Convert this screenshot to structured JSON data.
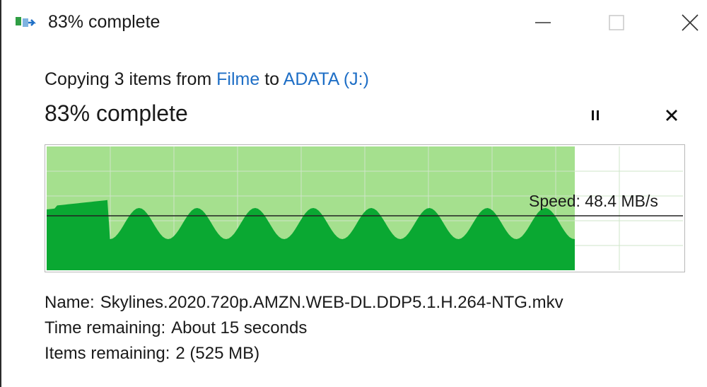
{
  "window": {
    "title": "83% complete",
    "controls": {
      "minimize": "minimize",
      "maximize": "maximize",
      "close": "close"
    }
  },
  "copy": {
    "prefix": "Copying 3 items from",
    "source": "Filme",
    "middle": "to",
    "destination": "ADATA (J:)"
  },
  "progress": {
    "label": "83% complete",
    "percent": 83
  },
  "speed": {
    "label": "Speed: 48.4 MB/s",
    "value_mb_s": 48.4
  },
  "details": {
    "name_label": "Name:",
    "name_value": "Skylines.2020.720p.AMZN.WEB-DL.DDP5.1.H.264-NTG.mkv",
    "time_label": "Time remaining:",
    "time_value": "About 15 seconds",
    "items_label": "Items remaining:",
    "items_value": "2 (525 MB)"
  },
  "colors": {
    "progress_fill": "#a5e08e",
    "speed_fill": "#0aa832",
    "grid": "#cfe5c8",
    "link": "#1f6fc6"
  },
  "icons": {
    "app": "file-copy-icon",
    "pause": "pause-icon",
    "stop": "stop-icon"
  }
}
